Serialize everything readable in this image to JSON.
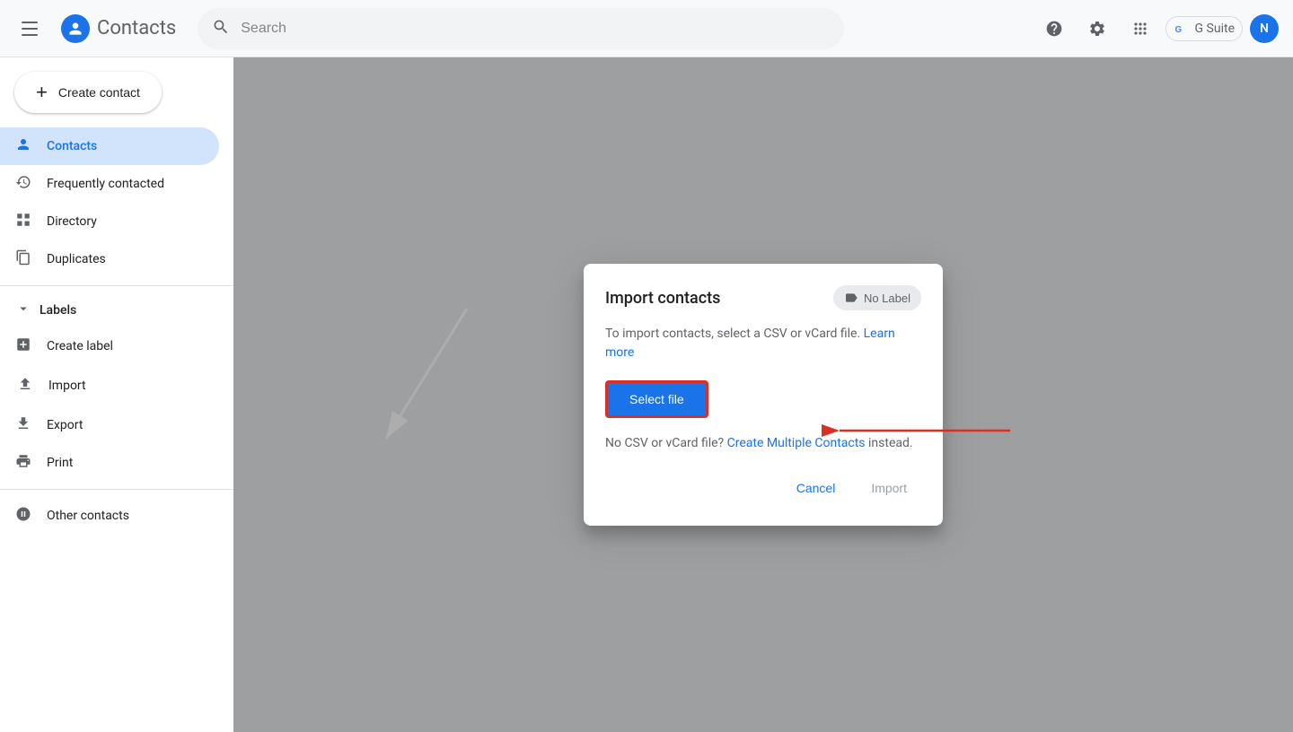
{
  "topbar": {
    "hamburger_label": "Main menu",
    "app_name": "Contacts",
    "search_placeholder": "Search",
    "help_title": "Help",
    "settings_title": "Settings",
    "apps_title": "Google apps",
    "gsuite_label": "G Suite",
    "user_initial": "N"
  },
  "sidebar": {
    "create_contact_label": "Create contact",
    "nav_items": [
      {
        "id": "contacts",
        "label": "Contacts",
        "icon": "person"
      },
      {
        "id": "frequently-contacted",
        "label": "Frequently contacted",
        "icon": "history"
      },
      {
        "id": "directory",
        "label": "Directory",
        "icon": "grid"
      },
      {
        "id": "duplicates",
        "label": "Duplicates",
        "icon": "duplicate"
      }
    ],
    "labels_section": "Labels",
    "create_label": "Create label",
    "bottom_items": [
      {
        "id": "import",
        "label": "Import",
        "icon": "upload"
      },
      {
        "id": "export",
        "label": "Export",
        "icon": "download"
      },
      {
        "id": "print",
        "label": "Print",
        "icon": "print"
      }
    ],
    "other_contacts": "Other contacts"
  },
  "modal": {
    "title": "Import contacts",
    "no_label_text": "No Label",
    "description": "To import contacts, select a CSV or vCard file.",
    "learn_more_text": "Learn more",
    "select_file_label": "Select file",
    "no_csv_prefix": "No CSV or vCard file?",
    "create_multiple_label": "Create Multiple Contacts",
    "no_csv_suffix": "instead.",
    "cancel_label": "Cancel",
    "import_label": "Import"
  },
  "bg_content": {
    "create_contact_label": "Create contact",
    "import_contacts_label": "Import contacts"
  }
}
